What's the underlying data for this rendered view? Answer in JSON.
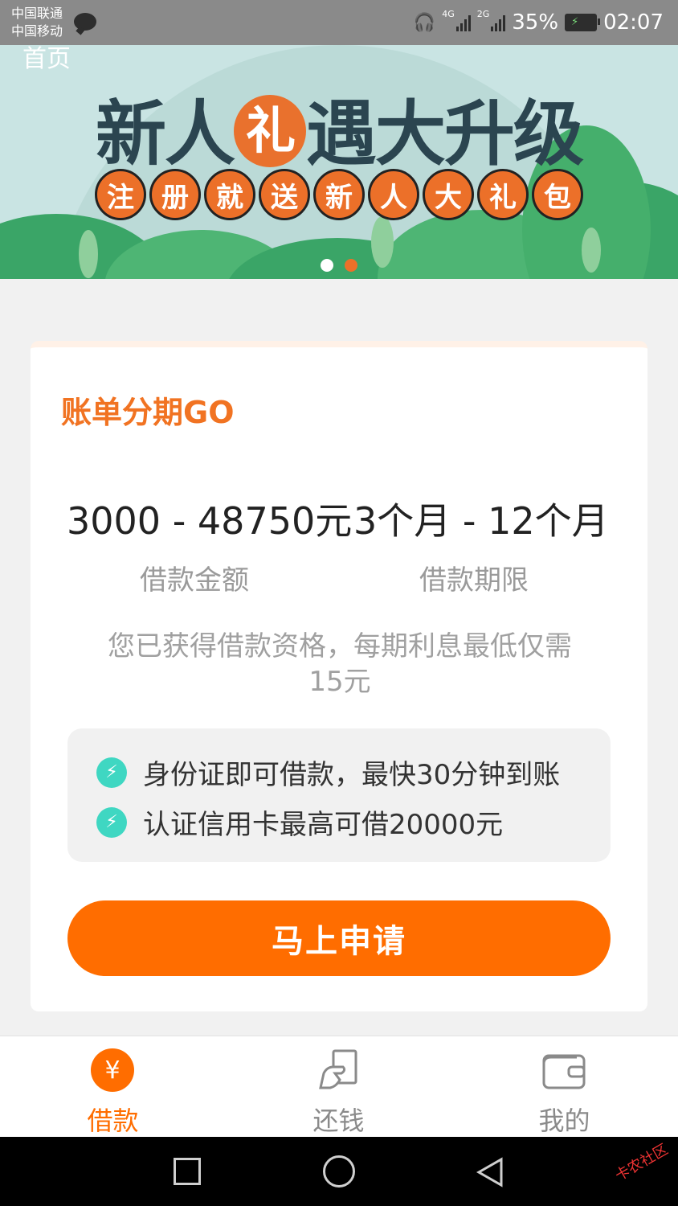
{
  "status_bar": {
    "carrier_1": "中国联通",
    "carrier_2": "中国移动",
    "net_1": "4G",
    "net_2": "2G",
    "battery": "35%",
    "time": "02:07"
  },
  "banner": {
    "top_text": "首页",
    "title_part1": "新人",
    "title_circle": "礼",
    "title_part2": "遇大升级",
    "pills": [
      "注",
      "册",
      "就",
      "送",
      "新",
      "人",
      "大",
      "礼",
      "包"
    ],
    "dots": [
      {
        "color": "#ffffff",
        "active": false
      },
      {
        "color": "#ec7029",
        "active": true
      }
    ]
  },
  "card": {
    "title": "账单分期GO",
    "amount_range": "3000 - 48750元",
    "term_range": "3个月 - 12个月",
    "amount_label": "借款金额",
    "term_label": "借款期限",
    "qualification_line1": "您已获得借款资格，每期利息最低仅需",
    "qualification_line2": "15元",
    "features": [
      {
        "icon": "bolt-icon",
        "text": "身份证即可借款，最快30分钟到账"
      },
      {
        "icon": "bolt-icon",
        "text": "认证信用卡最高可借20000元"
      }
    ],
    "apply_button": "马上申请"
  },
  "tabs": [
    {
      "label": "借款",
      "icon": "yen-icon",
      "active": true,
      "symbol": "¥"
    },
    {
      "label": "还钱",
      "icon": "repay-icon",
      "active": false
    },
    {
      "label": "我的",
      "icon": "wallet-icon",
      "active": false
    }
  ],
  "colors": {
    "accent": "#ff6d00",
    "title_orange": "#f17322",
    "feature_icon": "#3fd7c2",
    "tab_inactive": "#8a8a8a"
  },
  "watermark": "卡农社区"
}
